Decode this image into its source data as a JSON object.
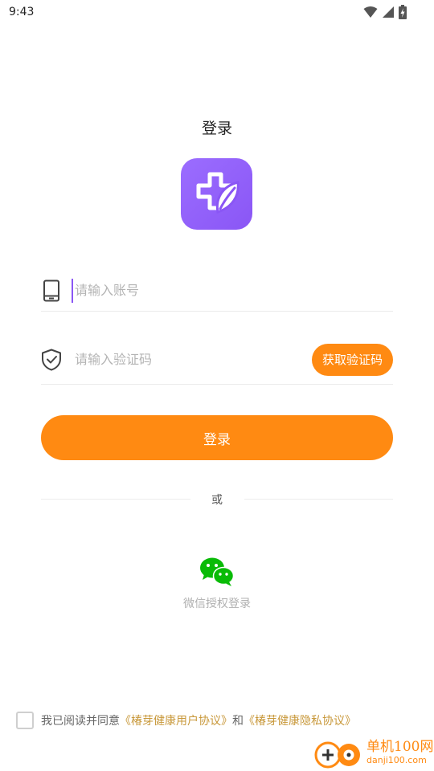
{
  "status_bar": {
    "time": "9:43",
    "icons": [
      "wifi-icon",
      "signal-icon",
      "battery-charging-icon"
    ]
  },
  "page": {
    "title": "登录"
  },
  "logo": {
    "icon": "health-cross-leaf-icon",
    "color": "#8a56f5"
  },
  "form": {
    "phone": {
      "icon": "phone-icon",
      "placeholder": "请输入账号",
      "value": ""
    },
    "code": {
      "icon": "shield-check-icon",
      "placeholder": "请输入验证码",
      "value": "",
      "get_code_label": "获取验证码"
    },
    "login_label": "登录"
  },
  "divider": {
    "text": "或"
  },
  "wechat": {
    "icon": "wechat-icon",
    "label": "微信授权登录",
    "color": "#09bb07"
  },
  "agreement": {
    "checked": false,
    "prefix": "我已阅读并同意",
    "user_agreement": "《椿芽健康用户协议》",
    "conjunction": "和",
    "privacy_agreement": "《椿芽健康隐私协议》"
  },
  "watermark": {
    "name": "单机100网",
    "url": "danji100.com"
  },
  "colors": {
    "accent": "#ff8a12",
    "brand": "#8a56f5",
    "link": "#c8983a"
  }
}
